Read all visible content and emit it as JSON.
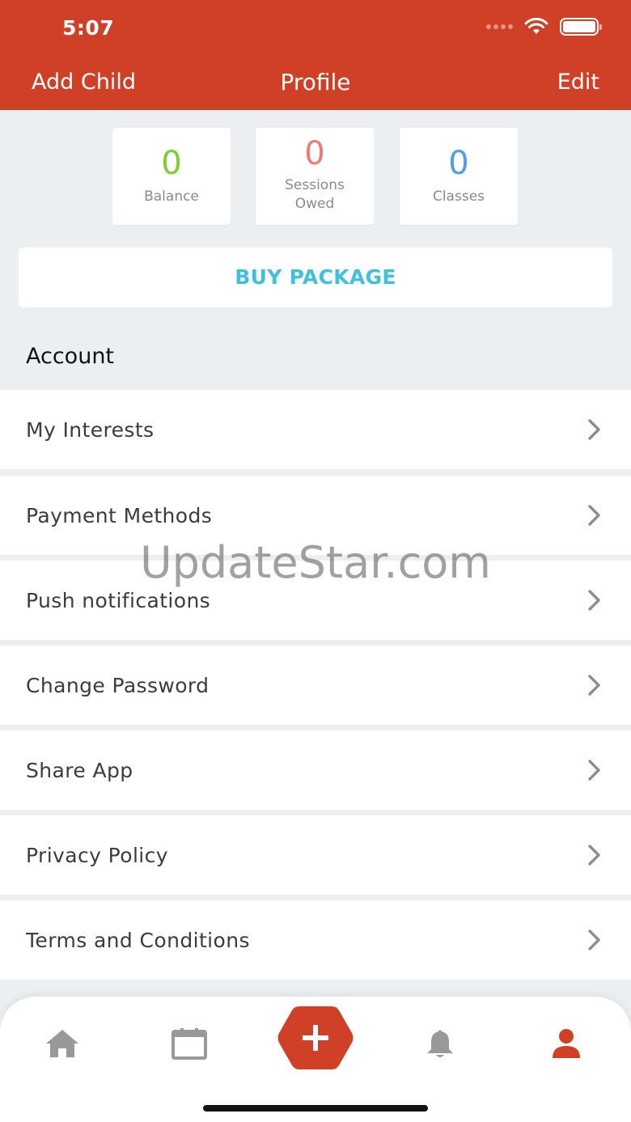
{
  "status_bar": {
    "time": "5:07"
  },
  "nav": {
    "left": "Add Child",
    "title": "Profile",
    "right": "Edit"
  },
  "stats": [
    {
      "value": "0",
      "label": "Balance",
      "color": "#7ccf2c"
    },
    {
      "value": "0",
      "label": "Sessions Owed",
      "color": "#f07a78"
    },
    {
      "value": "0",
      "label": "Classes",
      "color": "#4c9ff0"
    }
  ],
  "buy_package": "BUY PACKAGE",
  "section_title": "Account",
  "menu": [
    {
      "label": "My Interests"
    },
    {
      "label": "Payment Methods"
    },
    {
      "label": "Push notifications"
    },
    {
      "label": "Change Password"
    },
    {
      "label": "Share App"
    },
    {
      "label": "Privacy Policy"
    },
    {
      "label": "Terms and Conditions"
    }
  ],
  "watermark": "UpdateStar.com",
  "tabbar": {
    "tabs": [
      "home-icon",
      "calendar-icon",
      "add-icon",
      "bell-icon",
      "profile-icon"
    ],
    "active": "profile-icon",
    "accent": "#cf4026"
  }
}
